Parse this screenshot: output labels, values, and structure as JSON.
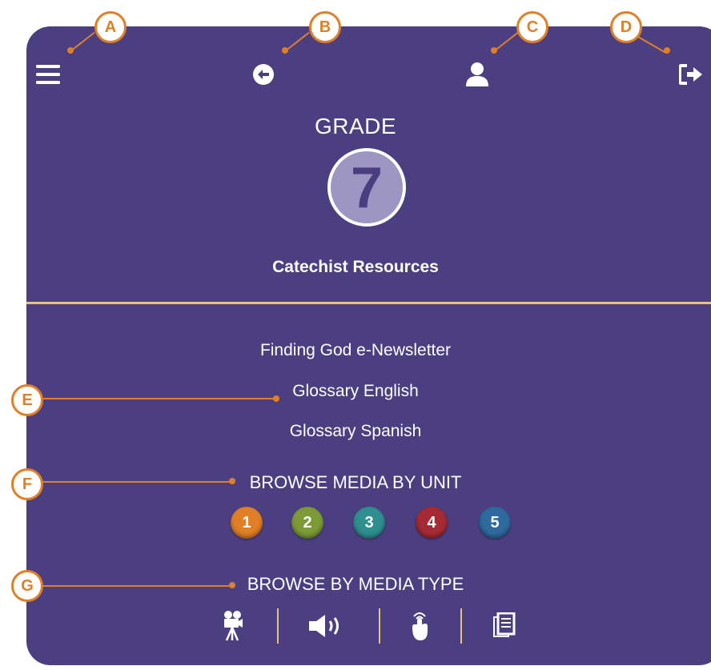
{
  "grade": {
    "label": "GRADE",
    "number": "7"
  },
  "heading": "Catechist Resources",
  "links": [
    "Finding God e-Newsletter",
    "Glossary English",
    "Glossary Spanish"
  ],
  "browse_unit": {
    "title": "BROWSE MEDIA BY UNIT",
    "units": [
      {
        "label": "1",
        "color": "#e07f26"
      },
      {
        "label": "2",
        "color": "#7c9a36"
      },
      {
        "label": "3",
        "color": "#2f8f8f"
      },
      {
        "label": "4",
        "color": "#a62a34"
      },
      {
        "label": "5",
        "color": "#2e6a9e"
      }
    ]
  },
  "browse_type": {
    "title": "BROWSE BY MEDIA TYPE",
    "types": [
      "video-camera-icon",
      "speaker-icon",
      "touch-icon",
      "document-icon"
    ]
  },
  "callouts": [
    "A",
    "B",
    "C",
    "D",
    "E",
    "F",
    "G"
  ],
  "colors": {
    "panel": "#4b3f81",
    "accent": "#e6c27e",
    "callout": "#e07f26"
  }
}
